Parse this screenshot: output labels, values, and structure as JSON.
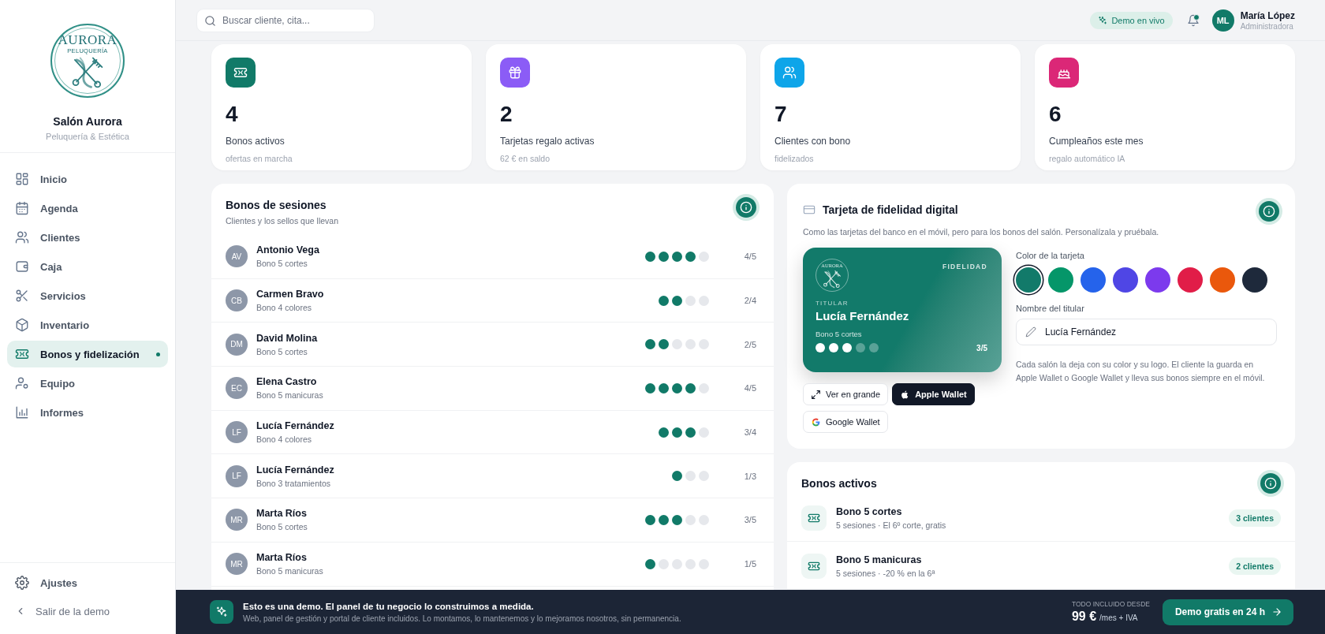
{
  "sidebar": {
    "logo": {
      "name": "AURORA",
      "tagline": "PELUQUERÍA"
    },
    "salon_name": "Salón Aurora",
    "salon_type": "Peluquería & Estética",
    "nav": [
      {
        "label": "Inicio",
        "selected": false
      },
      {
        "label": "Agenda",
        "selected": false
      },
      {
        "label": "Clientes",
        "selected": false
      },
      {
        "label": "Caja",
        "selected": false
      },
      {
        "label": "Servicios",
        "selected": false
      },
      {
        "label": "Inventario",
        "selected": false
      },
      {
        "label": "Bonos y fidelización",
        "selected": true
      },
      {
        "label": "Equipo",
        "selected": false
      },
      {
        "label": "Informes",
        "selected": false
      }
    ],
    "footer": [
      {
        "label": "Ajustes"
      },
      {
        "label": "Salir de la demo"
      }
    ]
  },
  "topbar": {
    "search": {
      "placeholder": "Buscar cliente, cita..."
    },
    "live_badge": "Demo en vivo",
    "has_notification": true,
    "user": {
      "initials": "ML",
      "name": "María López",
      "role": "Administradora"
    }
  },
  "stats": [
    {
      "value": "4",
      "label": "Bonos activos",
      "note": "ofertas en marcha",
      "color": "#117a68"
    },
    {
      "value": "2",
      "label": "Tarjetas regalo activas",
      "note": "62 € en saldo",
      "color": "#8b5cf6"
    },
    {
      "value": "7",
      "label": "Clientes con bono",
      "note": "fidelizados",
      "color": "#0ea5e9"
    },
    {
      "value": "6",
      "label": "Cumpleaños este mes",
      "note": "regalo automático IA",
      "color": "#db2777"
    }
  ],
  "session_bonuses": {
    "title": "Bonos de sesiones",
    "subtitle": "Clientes y los sellos que llevan",
    "rows": [
      {
        "initials": "AV",
        "name": "Antonio Vega",
        "bonus": "Bono 5 cortes",
        "stamps": [
          {
            "filled": true
          },
          {
            "filled": true
          },
          {
            "filled": true
          },
          {
            "filled": true
          },
          {
            "filled": false
          }
        ],
        "count": "4/5"
      },
      {
        "initials": "CB",
        "name": "Carmen Bravo",
        "bonus": "Bono 4 colores",
        "stamps": [
          {
            "filled": true
          },
          {
            "filled": true
          },
          {
            "filled": false
          },
          {
            "filled": false
          }
        ],
        "count": "2/4"
      },
      {
        "initials": "DM",
        "name": "David Molina",
        "bonus": "Bono 5 cortes",
        "stamps": [
          {
            "filled": true
          },
          {
            "filled": true
          },
          {
            "filled": false
          },
          {
            "filled": false
          },
          {
            "filled": false
          }
        ],
        "count": "2/5"
      },
      {
        "initials": "EC",
        "name": "Elena Castro",
        "bonus": "Bono 5 manicuras",
        "stamps": [
          {
            "filled": true
          },
          {
            "filled": true
          },
          {
            "filled": true
          },
          {
            "filled": true
          },
          {
            "filled": false
          }
        ],
        "count": "4/5"
      },
      {
        "initials": "LF",
        "name": "Lucía Fernández",
        "bonus": "Bono 4 colores",
        "stamps": [
          {
            "filled": true
          },
          {
            "filled": true
          },
          {
            "filled": true
          },
          {
            "filled": false
          }
        ],
        "count": "3/4"
      },
      {
        "initials": "LF",
        "name": "Lucía Fernández",
        "bonus": "Bono 3 tratamientos",
        "stamps": [
          {
            "filled": true
          },
          {
            "filled": false
          },
          {
            "filled": false
          }
        ],
        "count": "1/3"
      },
      {
        "initials": "MR",
        "name": "Marta Ríos",
        "bonus": "Bono 5 cortes",
        "stamps": [
          {
            "filled": true
          },
          {
            "filled": true
          },
          {
            "filled": true
          },
          {
            "filled": false
          },
          {
            "filled": false
          }
        ],
        "count": "3/5"
      },
      {
        "initials": "MR",
        "name": "Marta Ríos",
        "bonus": "Bono 5 manicuras",
        "stamps": [
          {
            "filled": true
          },
          {
            "filled": false
          },
          {
            "filled": false
          },
          {
            "filled": false
          },
          {
            "filled": false
          }
        ],
        "count": "1/5"
      }
    ]
  },
  "loyalty_card": {
    "title": "Tarjeta de fidelidad digital",
    "description": "Como las tarjetas del banco en el móvil, pero para los bonos del salón. Personalízala y pruébala.",
    "card": {
      "logo_name": "AURORA",
      "badge": "FIDELIDAD",
      "holder_label": "TITULAR",
      "holder": "Lucía Fernández",
      "bonus": "Bono 5 cortes",
      "stamps": [
        {
          "filled": true
        },
        {
          "filled": true
        },
        {
          "filled": true
        },
        {
          "filled": false
        },
        {
          "filled": false
        }
      ],
      "count": "3/5"
    },
    "color_label": "Color de la tarjeta",
    "colors": [
      {
        "color": "#127a6a",
        "selected": true
      },
      {
        "color": "#059669",
        "selected": false
      },
      {
        "color": "#2563eb",
        "selected": false
      },
      {
        "color": "#4f46e5",
        "selected": false
      },
      {
        "color": "#7c3aed",
        "selected": false
      },
      {
        "color": "#e11d48",
        "selected": false
      },
      {
        "color": "#ea580c",
        "selected": false
      },
      {
        "color": "#1e293b",
        "selected": false
      }
    ],
    "name_label": "Nombre del titular",
    "name_value": "Lucía Fernández",
    "note": "Cada salón la deja con su color y su logo. El cliente la guarda en Apple Wallet o Google Wallet y lleva sus bonos siempre en el móvil.",
    "buttons": [
      {
        "kind": "expand",
        "label": "Ver en grande"
      },
      {
        "kind": "apple",
        "label": "Apple Wallet"
      },
      {
        "kind": "google",
        "label": "Google Wallet"
      }
    ]
  },
  "active_bonuses": {
    "title": "Bonos activos",
    "items": [
      {
        "name": "Bono 5 cortes",
        "detail": "5 sesiones · El 6º corte, gratis",
        "clients": "3 clientes"
      },
      {
        "name": "Bono 5 manicuras",
        "detail": "5 sesiones · -20 % en la 6ª",
        "clients": "2 clientes"
      }
    ]
  },
  "demo_banner": {
    "title": "Esto es una demo. El panel de tu negocio lo construimos a medida.",
    "text": "Web, panel de gestión y portal de cliente incluidos. Lo montamos, lo mantenemos y lo mejoramos nosotros, sin permanencia.",
    "price_label": "TODO INCLUIDO DESDE",
    "price": "99 €",
    "price_unit": "/mes + IVA",
    "cta": "Demo gratis en 24 h"
  }
}
